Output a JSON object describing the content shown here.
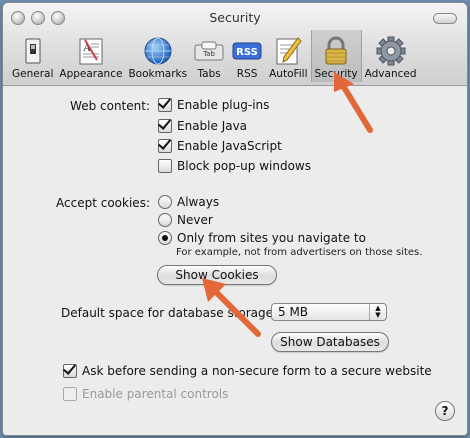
{
  "window": {
    "title": "Security"
  },
  "toolbar": {
    "items": [
      {
        "label": "General",
        "icon": "general-switch-icon"
      },
      {
        "label": "Appearance",
        "icon": "appearance-icon"
      },
      {
        "label": "Bookmarks",
        "icon": "globe-icon"
      },
      {
        "label": "Tabs",
        "icon": "tabs-icon"
      },
      {
        "label": "RSS",
        "icon": "rss-icon"
      },
      {
        "label": "AutoFill",
        "icon": "autofill-pencil-icon"
      },
      {
        "label": "Security",
        "icon": "lock-icon",
        "selected": true
      },
      {
        "label": "Advanced",
        "icon": "gear-icon"
      }
    ],
    "tabs_icon_text": "Tab",
    "rss_icon_text": "RSS"
  },
  "web_content": {
    "label": "Web content:",
    "options": [
      {
        "label": "Enable plug-ins",
        "checked": true
      },
      {
        "label": "Enable Java",
        "checked": true
      },
      {
        "label": "Enable JavaScript",
        "checked": true
      },
      {
        "label": "Block pop-up windows",
        "checked": false
      }
    ]
  },
  "cookies": {
    "label": "Accept cookies:",
    "options": [
      {
        "label": "Always",
        "selected": false
      },
      {
        "label": "Never",
        "selected": false
      },
      {
        "label": "Only from sites you navigate to",
        "selected": true
      }
    ],
    "note": "For example, not from advertisers on those sites.",
    "show_button": "Show Cookies"
  },
  "database": {
    "label": "Default space for database storage:",
    "value": "5 MB",
    "show_button": "Show Databases"
  },
  "bottom_options": [
    {
      "label": "Ask before sending a non-secure form to a secure website",
      "checked": true,
      "enabled": true
    },
    {
      "label": "Enable parental controls",
      "checked": false,
      "enabled": false
    }
  ],
  "help": {
    "label": "?"
  },
  "colors": {
    "annotation_arrow": "#e2683a",
    "desktop": "#6d8fb3"
  }
}
